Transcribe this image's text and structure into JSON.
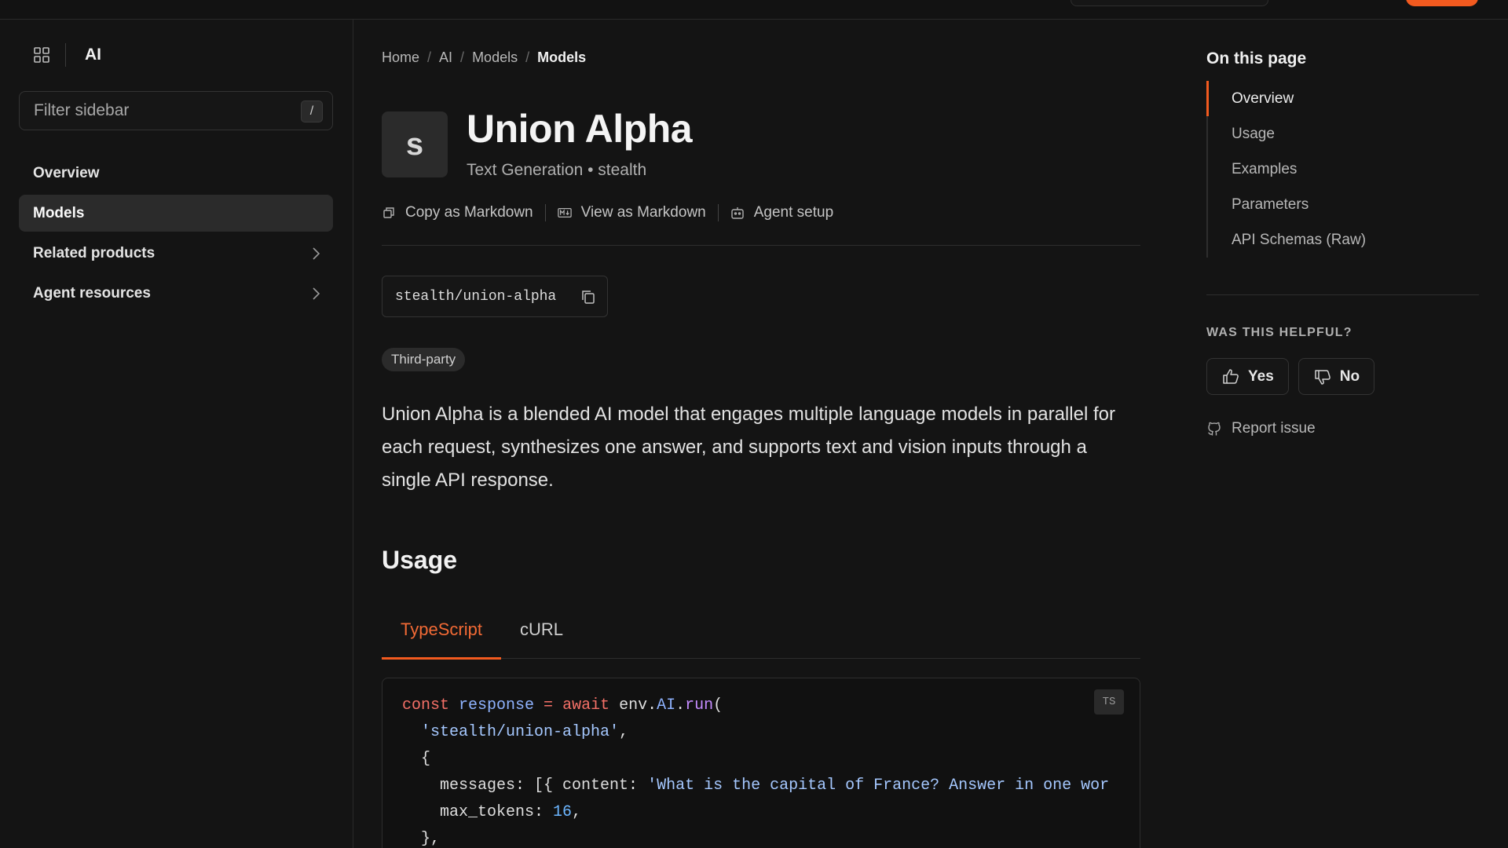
{
  "sidebar": {
    "title": "AI",
    "filter_placeholder": "Filter sidebar",
    "filter_shortcut": "/",
    "items": [
      {
        "label": "Overview"
      },
      {
        "label": "Models"
      },
      {
        "label": "Related products"
      },
      {
        "label": "Agent resources"
      }
    ]
  },
  "breadcrumb": [
    "Home",
    "AI",
    "Models",
    "Models"
  ],
  "model": {
    "avatar_letter": "s",
    "title": "Union Alpha",
    "subtitle": "Text Generation • stealth",
    "id": "stealth/union-alpha",
    "badge": "Third-party",
    "description": "Union Alpha is a blended AI model that engages multiple language models in parallel for each request, synthesizes one answer, and supports text and vision inputs through a single API response."
  },
  "actions": {
    "copy_markdown": "Copy as Markdown",
    "view_markdown": "View as Markdown",
    "agent_setup": "Agent setup"
  },
  "usage": {
    "heading": "Usage",
    "tabs": [
      "TypeScript",
      "cURL"
    ],
    "active_tab": "TypeScript",
    "lang_badge": "TS",
    "code": {
      "l1_const": "const",
      "l1_var": "response",
      "l1_eq": " = ",
      "l1_await": "await",
      "l1_env": " env.",
      "l1_ai": "AI",
      "l1_dot": ".",
      "l1_run": "run",
      "l1_paren": "(",
      "l2_str": "'stealth/union-alpha'",
      "l2_comma": ",",
      "l3": "{",
      "l4_key": "messages: [{ content: ",
      "l4_str": "'What is the capital of France? Answer in one wor",
      "l5_key": "max_tokens: ",
      "l5_num": "16",
      "l5_comma": ",",
      "l6": "},"
    }
  },
  "toc": {
    "title": "On this page",
    "items": [
      "Overview",
      "Usage",
      "Examples",
      "Parameters",
      "API Schemas (Raw)"
    ],
    "active": "Overview"
  },
  "feedback": {
    "question": "WAS THIS HELPFUL?",
    "yes": "Yes",
    "no": "No",
    "report": "Report issue"
  },
  "colors": {
    "accent": "#f25a1f",
    "background": "#141414"
  }
}
